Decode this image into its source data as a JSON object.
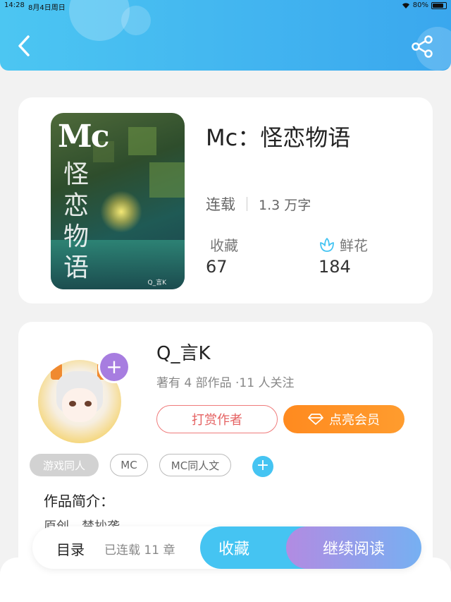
{
  "status_bar": {
    "time": "14:28",
    "date": "8月4日周日",
    "battery": "80%"
  },
  "header": {
    "back_icon": "chevron-left-icon",
    "share_icon": "share-icon",
    "color": "#3fb2ef"
  },
  "book": {
    "title": "Mc：怪恋物语",
    "status": "连载",
    "word_count": "1.3 万字",
    "favorites_label": "收藏",
    "favorites_count": "67",
    "flowers_label": "鲜花",
    "flowers_count": "184",
    "cover": {
      "title_en": "Mc",
      "title_cn": "怪恋物语",
      "credit": "Q_言K"
    }
  },
  "author": {
    "name": "Q_言K",
    "meta": "著有 4 部作品 ·11 人关注",
    "tip_label": "打赏作者",
    "vip_label": "点亮会员",
    "tags": [
      "游戏同人",
      "MC",
      "MC同人文"
    ],
    "intro_title": "作品简介：",
    "intro_text": "原创，禁抄袭"
  },
  "bottom_bar": {
    "toc_label": "目录",
    "toc_count": "已连载 11 章",
    "favorite_label": "收藏",
    "read_label": "继续阅读"
  },
  "colors": {
    "accent_blue": "#45c4f2",
    "tip_red": "#e56262",
    "vip_orange": "#ff8a1f",
    "read_purple": "#b28be2"
  }
}
